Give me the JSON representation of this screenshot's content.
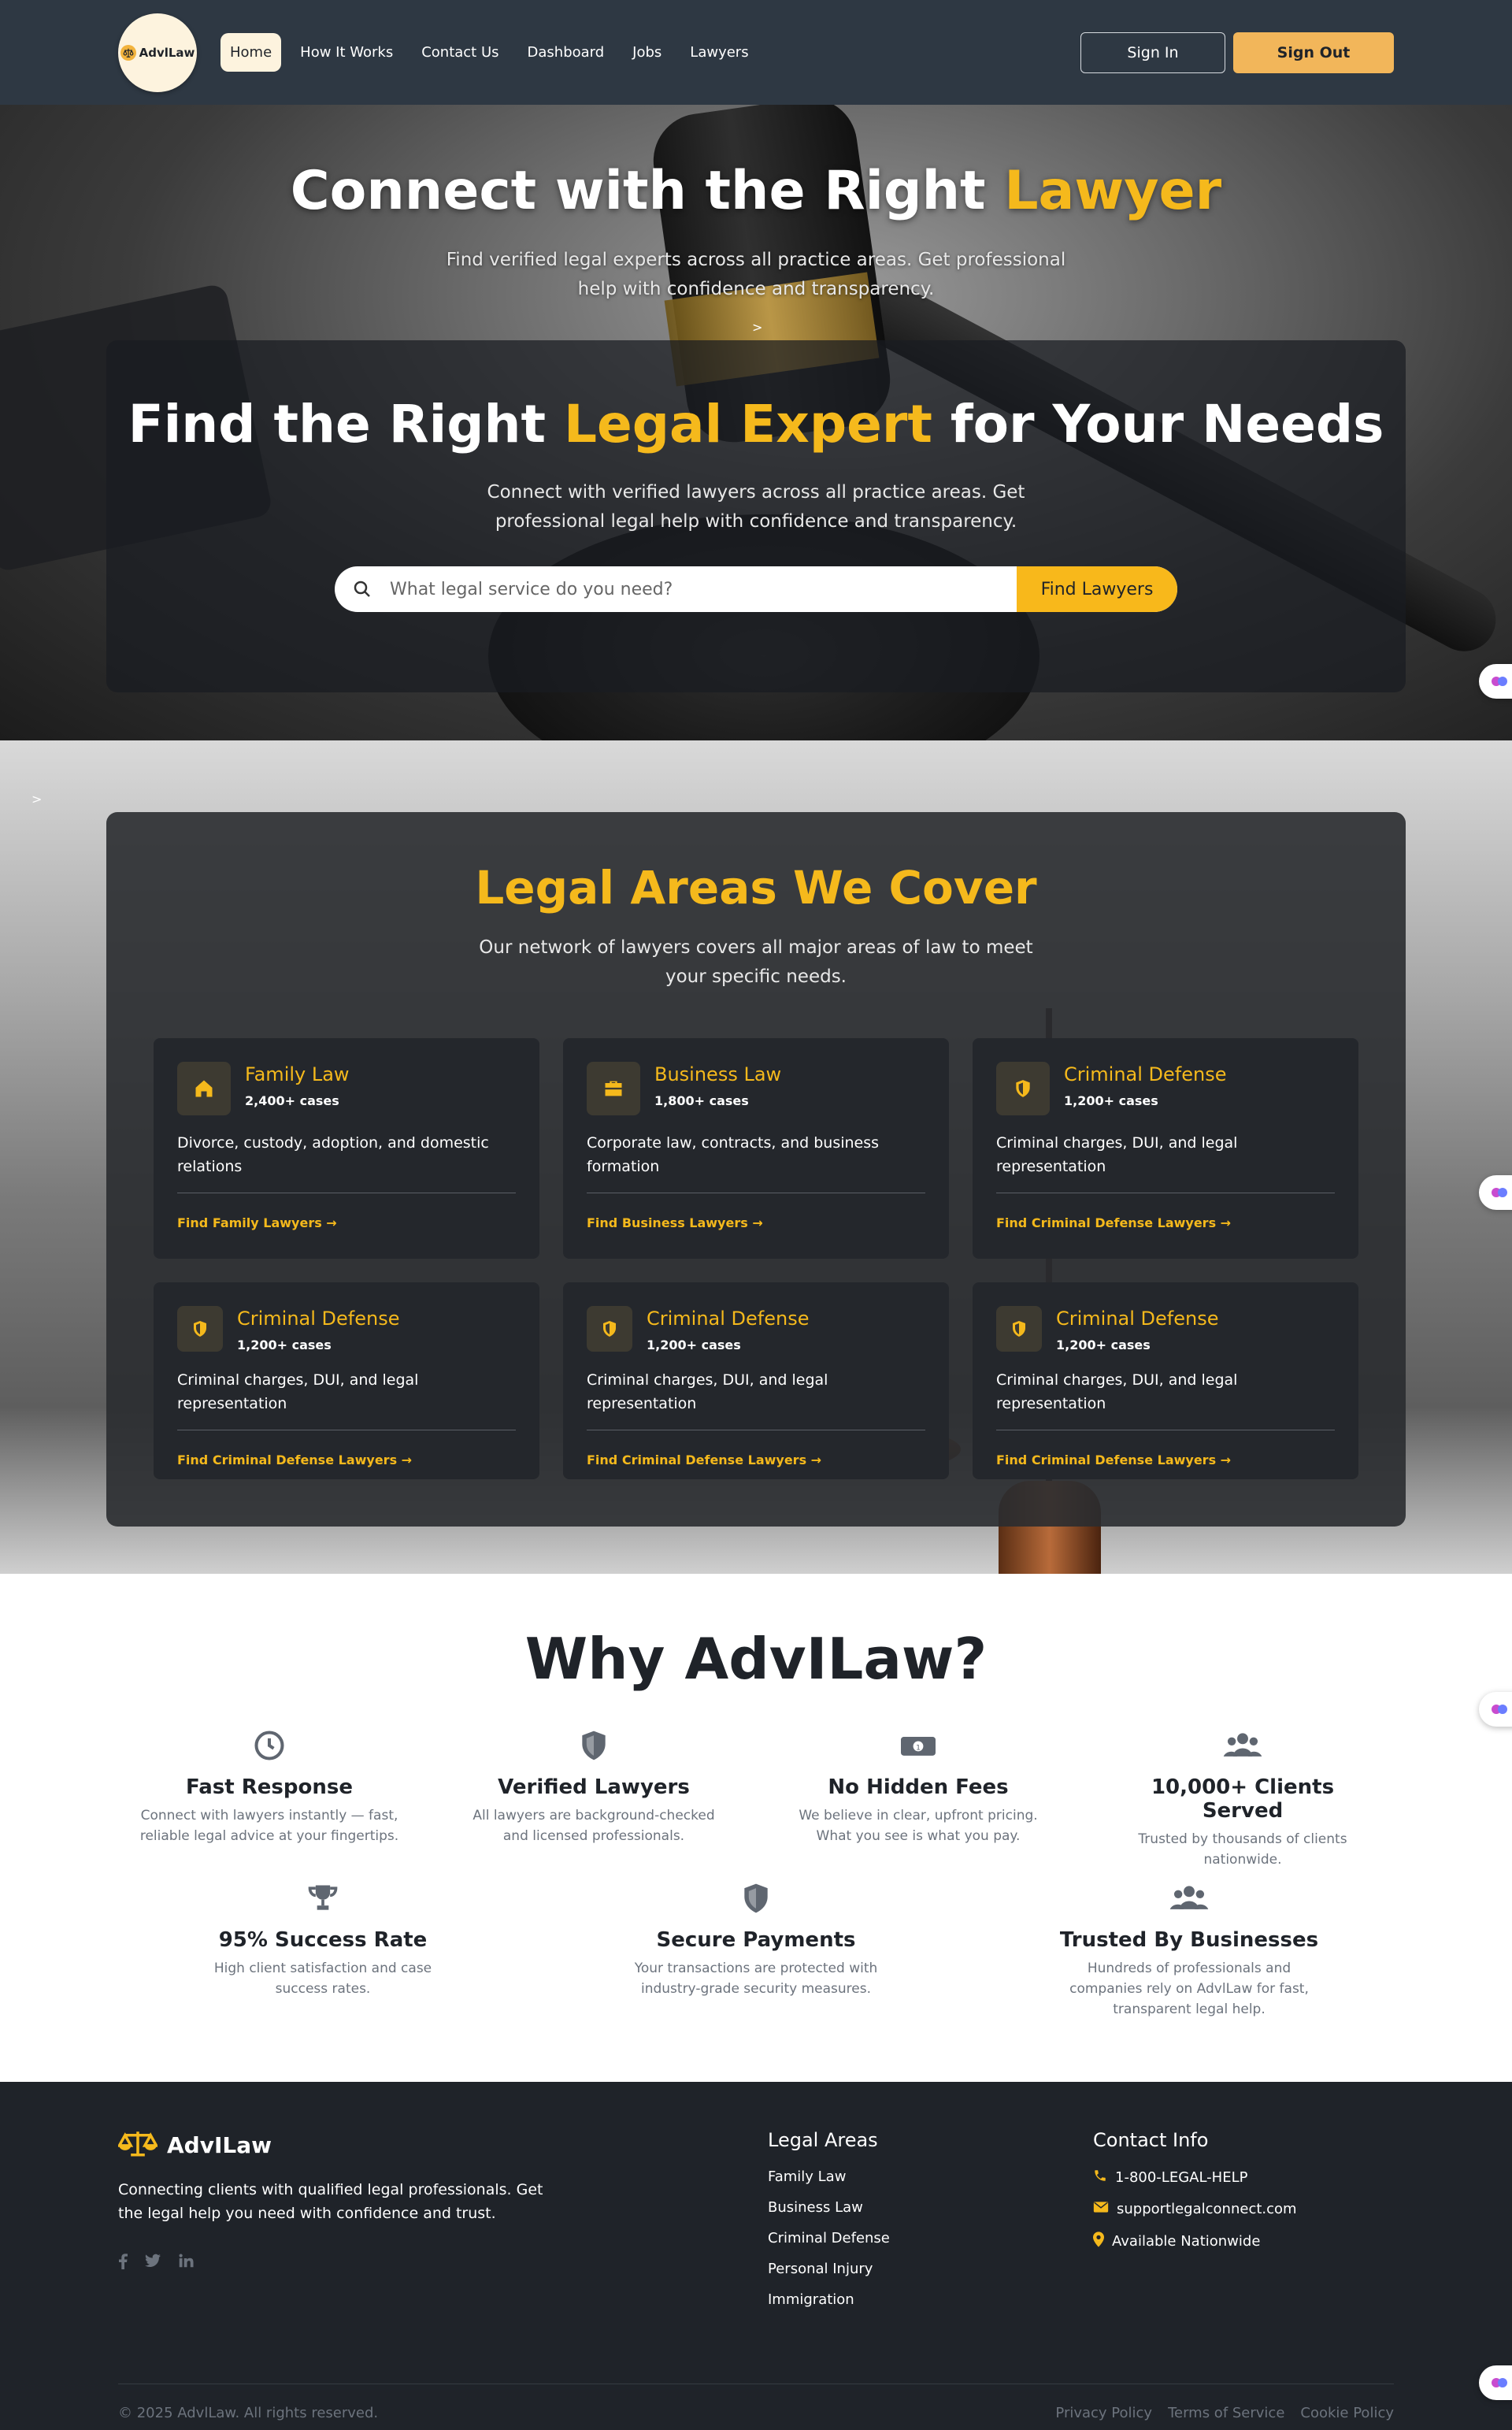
{
  "nav": {
    "logo_text": "AdvlLaw",
    "links": [
      "Home",
      "How It Works",
      "Contact Us",
      "Dashboard",
      "Jobs",
      "Lawyers"
    ],
    "sign_in": "Sign In",
    "sign_out": "Sign Out"
  },
  "hero": {
    "title_main": "Connect with the Right ",
    "title_accent": "Lawyer",
    "subtitle": "Find verified legal experts across all practice areas. Get professional help with confidence and transparency.",
    "caret": ">",
    "panel_title_pre": "Find the Right ",
    "panel_title_accent": "Legal Expert",
    "panel_title_post": " for Your Needs",
    "panel_subtitle": "Connect with verified lawyers across all practice areas. Get professional legal help with confidence and transparency.",
    "search_placeholder": "What legal service do you need?",
    "search_button": "Find Lawyers"
  },
  "areas": {
    "caret": ">",
    "title": "Legal Areas We Cover",
    "subtitle": "Our network of lawyers covers all major areas of law to meet your specific needs.",
    "cards": [
      {
        "icon": "home-icon",
        "title": "Family Law",
        "count": "2,400+ cases",
        "desc": "Divorce, custody, adoption, and domestic relations",
        "link": "Find Family Lawyers →"
      },
      {
        "icon": "briefcase-icon",
        "title": "Business Law",
        "count": "1,800+ cases",
        "desc": "Corporate law, contracts, and business formation",
        "link": "Find Business Lawyers →"
      },
      {
        "icon": "shield-icon",
        "title": "Criminal Defense",
        "count": "1,200+ cases",
        "desc": "Criminal charges, DUI, and legal representation",
        "link": "Find Criminal Defense Lawyers →"
      },
      {
        "icon": "shield-icon",
        "title": "Criminal Defense",
        "count": "1,200+ cases",
        "desc": "Criminal charges, DUI, and legal representation",
        "link": "Find Criminal Defense Lawyers →"
      },
      {
        "icon": "shield-icon",
        "title": "Criminal Defense",
        "count": "1,200+ cases",
        "desc": "Criminal charges, DUI, and legal representation",
        "link": "Find Criminal Defense Lawyers →"
      },
      {
        "icon": "shield-icon",
        "title": "Criminal Defense",
        "count": "1,200+ cases",
        "desc": "Criminal charges, DUI, and legal representation",
        "link": "Find Criminal Defense Lawyers →"
      }
    ]
  },
  "why": {
    "title": "Why AdvILaw?",
    "items": [
      {
        "icon": "clock-icon",
        "title": "Fast Response",
        "desc": "Connect with lawyers instantly — fast, reliable legal advice at your fingertips."
      },
      {
        "icon": "shield-icon",
        "title": "Verified Lawyers",
        "desc": "All lawyers are background-checked and licensed professionals."
      },
      {
        "icon": "money-icon",
        "title": "No Hidden Fees",
        "desc": "We believe in clear, upfront pricing. What you see is what you pay."
      },
      {
        "icon": "users-icon",
        "title": "10,000+ Clients Served",
        "desc": "Trusted by thousands of clients nationwide."
      },
      {
        "icon": "trophy-icon",
        "title": "95% Success Rate",
        "desc": "High client satisfaction and case success rates."
      },
      {
        "icon": "shield-icon",
        "title": "Secure Payments",
        "desc": "Your transactions are protected with industry-grade security measures."
      },
      {
        "icon": "users-icon",
        "title": "Trusted By Businesses",
        "desc": "Hundreds of professionals and companies rely on AdvlLaw for fast, transparent legal help."
      }
    ]
  },
  "footer": {
    "brand": "AdvILaw",
    "desc": "Connecting clients with qualified legal professionals. Get the legal help you need with confidence and trust.",
    "socials": [
      "facebook-icon",
      "twitter-icon",
      "linkedin-icon"
    ],
    "legal_title": "Legal Areas",
    "legal_items": [
      "Family Law",
      "Business Law",
      "Criminal Defense",
      "Personal Injury",
      "Immigration"
    ],
    "contact_title": "Contact Info",
    "contact_items": [
      {
        "icon": "phone-icon",
        "text": "1-800-LEGAL-HELP"
      },
      {
        "icon": "mail-icon",
        "text": "supportlegalconnect.com"
      },
      {
        "icon": "location-icon",
        "text": "Available Nationwide"
      }
    ],
    "copyright": "© 2025 AdvlLaw. All rights reserved.",
    "bottom_links": [
      "Privacy Policy",
      "Terms of Service",
      "Cookie Policy"
    ]
  },
  "colors": {
    "accent": "#f5b91c",
    "nav_bg": "#2e3843",
    "footer_bg": "#1f2329"
  }
}
